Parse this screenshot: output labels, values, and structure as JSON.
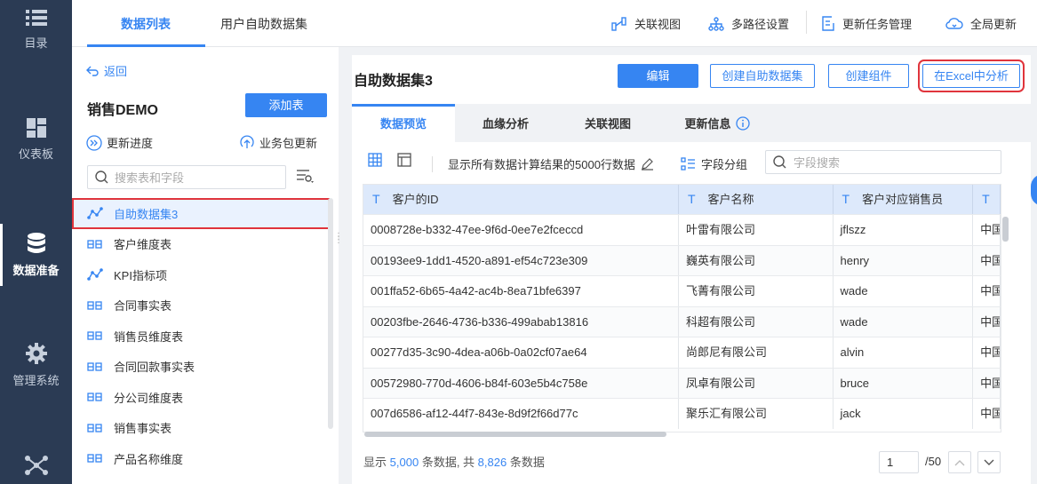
{
  "leftnav": {
    "items": [
      {
        "label": "目录",
        "icon": "list-icon"
      },
      {
        "label": "仪表板",
        "icon": "dashboard-icon"
      },
      {
        "label": "数据准备",
        "icon": "database-icon"
      },
      {
        "label": "管理系统",
        "icon": "gear-icon"
      },
      {
        "label": "",
        "icon": "network-icon"
      }
    ]
  },
  "topbar": {
    "tabs": [
      "数据列表",
      "用户自助数据集"
    ],
    "actions": [
      "关联视图",
      "多路径设置",
      "更新任务管理",
      "全局更新"
    ]
  },
  "sidepanel": {
    "back": "返回",
    "title": "销售DEMO",
    "add_table": "添加表",
    "update_progress": "更新进度",
    "pkg_update": "业务包更新",
    "search_placeholder": "搜索表和字段",
    "tables": [
      {
        "name": "自助数据集3",
        "type": "selfservice"
      },
      {
        "name": "客户维度表",
        "type": "db"
      },
      {
        "name": "KPI指标项",
        "type": "selfservice"
      },
      {
        "name": "合同事实表",
        "type": "db"
      },
      {
        "name": "销售员维度表",
        "type": "db"
      },
      {
        "name": "合同回款事实表",
        "type": "db"
      },
      {
        "name": "分公司维度表",
        "type": "db"
      },
      {
        "name": "销售事实表",
        "type": "db"
      },
      {
        "name": "产品名称维度",
        "type": "db"
      }
    ]
  },
  "main": {
    "title": "自助数据集3",
    "buttons": {
      "edit": "编辑",
      "create_dataset": "创建自助数据集",
      "create_component": "创建组件",
      "excel": "在Excel中分析"
    },
    "tabs": [
      "数据预览",
      "血缘分析",
      "关联视图",
      "更新信息"
    ],
    "toolbar": {
      "info": "显示所有数据计算结果的5000行数据",
      "group": "字段分组",
      "search_placeholder": "字段搜索"
    },
    "columns": [
      "客户的ID",
      "客户名称",
      "客户对应销售员",
      ""
    ],
    "rows": [
      [
        "0008728e-b332-47ee-9f6d-0ee7e2fceccd",
        "叶雷有限公司",
        "jflszz",
        "中国"
      ],
      [
        "00193ee9-1dd1-4520-a891-ef54c723e309",
        "巍英有限公司",
        "henry",
        "中国"
      ],
      [
        "001ffa52-6b65-4a42-ac4b-8ea71bfe6397",
        "飞菁有限公司",
        "wade",
        "中国"
      ],
      [
        "00203fbe-2646-4736-b336-499abab13816",
        "科超有限公司",
        "wade",
        "中国"
      ],
      [
        "00277d35-3c90-4dea-a06b-0a02cf07ae64",
        "尚郎尼有限公司",
        "alvin",
        "中国"
      ],
      [
        "00572980-770d-4606-b84f-603e5b4c758e",
        "凤卓有限公司",
        "bruce",
        "中国"
      ],
      [
        "007d6586-af12-44f7-843e-8d9f2f66d77c",
        "聚乐汇有限公司",
        "jack",
        "中国"
      ]
    ],
    "footer": {
      "prefix": "显示",
      "shown": "5,000",
      "mid": "条数据, 共",
      "total": "8,826",
      "suffix": "条数据",
      "page": "1",
      "pages": "/50"
    }
  },
  "colors": {
    "accent": "#3685f2",
    "nav_bg": "#2b3b54",
    "highlight_red": "#e0343c"
  }
}
